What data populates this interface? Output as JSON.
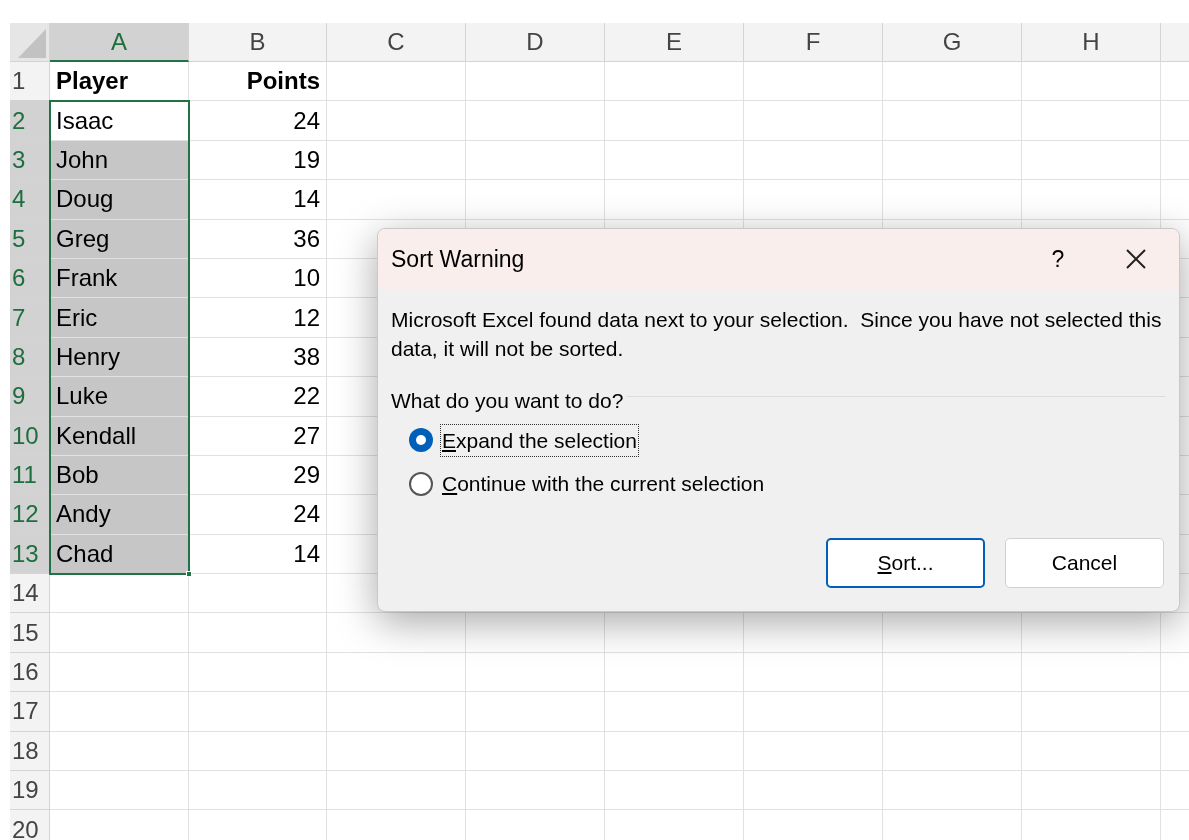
{
  "columns": [
    {
      "label": "A",
      "selected": true
    },
    {
      "label": "B",
      "selected": false
    },
    {
      "label": "C",
      "selected": false
    },
    {
      "label": "D",
      "selected": false
    },
    {
      "label": "E",
      "selected": false
    },
    {
      "label": "F",
      "selected": false
    },
    {
      "label": "G",
      "selected": false
    },
    {
      "label": "H",
      "selected": false
    }
  ],
  "rows": [
    {
      "label": "1",
      "selected": false,
      "kind": "header",
      "active": false,
      "cells": [
        "Player",
        "Points"
      ]
    },
    {
      "label": "2",
      "selected": true,
      "kind": "data",
      "active": true,
      "cells": [
        "Isaac",
        "24"
      ]
    },
    {
      "label": "3",
      "selected": true,
      "kind": "data",
      "active": false,
      "cells": [
        "John",
        "19"
      ]
    },
    {
      "label": "4",
      "selected": true,
      "kind": "data",
      "active": false,
      "cells": [
        "Doug",
        "14"
      ]
    },
    {
      "label": "5",
      "selected": true,
      "kind": "data",
      "active": false,
      "cells": [
        "Greg",
        "36"
      ]
    },
    {
      "label": "6",
      "selected": true,
      "kind": "data",
      "active": false,
      "cells": [
        "Frank",
        "10"
      ]
    },
    {
      "label": "7",
      "selected": true,
      "kind": "data",
      "active": false,
      "cells": [
        "Eric",
        "12"
      ]
    },
    {
      "label": "8",
      "selected": true,
      "kind": "data",
      "active": false,
      "cells": [
        "Henry",
        "38"
      ]
    },
    {
      "label": "9",
      "selected": true,
      "kind": "data",
      "active": false,
      "cells": [
        "Luke",
        "22"
      ]
    },
    {
      "label": "10",
      "selected": true,
      "kind": "data",
      "active": false,
      "cells": [
        "Kendall",
        "27"
      ]
    },
    {
      "label": "11",
      "selected": true,
      "kind": "data",
      "active": false,
      "cells": [
        "Bob",
        "29"
      ]
    },
    {
      "label": "12",
      "selected": true,
      "kind": "data",
      "active": false,
      "cells": [
        "Andy",
        "24"
      ]
    },
    {
      "label": "13",
      "selected": true,
      "kind": "data",
      "active": false,
      "cells": [
        "Chad",
        "14"
      ]
    },
    {
      "label": "14",
      "selected": false,
      "kind": "data",
      "active": false,
      "cells": []
    },
    {
      "label": "15",
      "selected": false,
      "kind": "data",
      "active": false,
      "cells": []
    },
    {
      "label": "16",
      "selected": false,
      "kind": "data",
      "active": false,
      "cells": []
    },
    {
      "label": "17",
      "selected": false,
      "kind": "data",
      "active": false,
      "cells": []
    },
    {
      "label": "18",
      "selected": false,
      "kind": "data",
      "active": false,
      "cells": []
    },
    {
      "label": "19",
      "selected": false,
      "kind": "data",
      "active": false,
      "cells": []
    },
    {
      "label": "20",
      "selected": false,
      "kind": "data",
      "active": false,
      "cells": []
    }
  ],
  "dialog": {
    "title": "Sort Warning",
    "help": "?",
    "message": "Microsoft Excel found data next to your selection.  Since you have not selected this data, it will not be sorted.",
    "prompt": "What do you want to do?",
    "options": [
      {
        "access_key": "E",
        "label_rest": "xpand the selection",
        "selected": true
      },
      {
        "access_key": "C",
        "label_rest": "ontinue with the current selection",
        "selected": false
      }
    ],
    "buttons": [
      {
        "access_key": "S",
        "label_rest": "ort...",
        "default": true
      },
      {
        "label_rest": "Cancel",
        "default": false
      }
    ]
  }
}
